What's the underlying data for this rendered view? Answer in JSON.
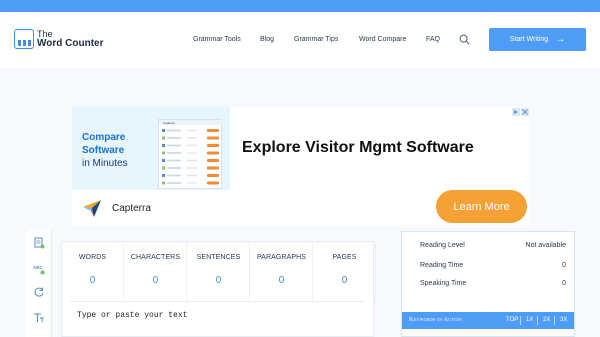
{
  "brand": {
    "line1": "The",
    "line2": "Word Counter"
  },
  "nav": [
    "Grammar Tools",
    "Blog",
    "Grammar Tips",
    "Word Compare",
    "FAQ"
  ],
  "cta": {
    "label": "Start Writing",
    "arrow": "→"
  },
  "ad": {
    "compare_lines": [
      "Compare",
      "Software",
      "in Minutes"
    ],
    "brand_in_shot": "Capterra",
    "headline": "Explore Visitor Mgmt Software",
    "advertiser": "Capterra",
    "button": "Learn More"
  },
  "stats": [
    {
      "label": "WORDS",
      "value": "0"
    },
    {
      "label": "CHARACTERS",
      "value": "0"
    },
    {
      "label": "SENTENCES",
      "value": "0"
    },
    {
      "label": "PARAGRAPHS",
      "value": "0"
    },
    {
      "label": "PAGES",
      "value": "0"
    }
  ],
  "editor": {
    "placeholder": "Type or paste your text"
  },
  "details": [
    {
      "label": "Reading Level",
      "value": "Not available"
    },
    {
      "label": "Reading Time",
      "value": "0"
    },
    {
      "label": "Speaking Time",
      "value": "0"
    }
  ],
  "keywords": {
    "title": "Keywords in Action",
    "tabs": [
      "TOP",
      "1X",
      "2X",
      "3X"
    ]
  },
  "colors": {
    "accent": "#4f9cf7",
    "ad_button": "#f7a134",
    "value_blue": "#3e8be8"
  }
}
